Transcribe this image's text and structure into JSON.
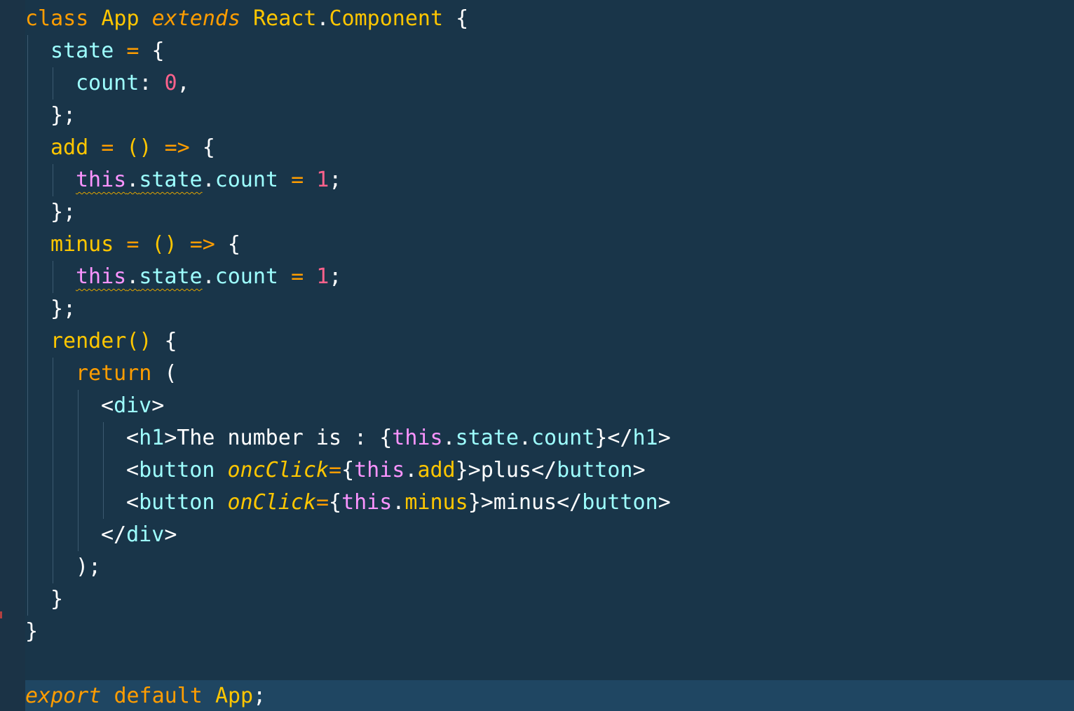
{
  "colors": {
    "background": "#193549",
    "gutter": "#1b3346",
    "active_line": "#1f4662",
    "keyword": "#ff9d00",
    "class_name": "#ffc600",
    "property": "#9effff",
    "this_keyword": "#fb94ff",
    "number": "#ff628c",
    "plain": "#ffffff",
    "indent_guide": "#3c5a70",
    "warning_squiggle": "#e0a400"
  },
  "editor": {
    "active_line_index": 21,
    "lines": [
      {
        "indent": 0,
        "tokens": [
          {
            "t": "class",
            "c": "keyword"
          },
          {
            "t": " "
          },
          {
            "t": "App",
            "c": "class_name"
          },
          {
            "t": " "
          },
          {
            "t": "extends",
            "c": "keyword",
            "italic": true
          },
          {
            "t": " "
          },
          {
            "t": "React",
            "c": "class_name"
          },
          {
            "t": "."
          },
          {
            "t": "Component",
            "c": "class_name"
          },
          {
            "t": " {"
          }
        ]
      },
      {
        "indent": 1,
        "tokens": [
          {
            "t": "state",
            "c": "property"
          },
          {
            "t": " "
          },
          {
            "t": "=",
            "c": "keyword"
          },
          {
            "t": " {"
          }
        ]
      },
      {
        "indent": 2,
        "tokens": [
          {
            "t": "count",
            "c": "property"
          },
          {
            "t": ": "
          },
          {
            "t": "0",
            "c": "number"
          },
          {
            "t": ","
          }
        ]
      },
      {
        "indent": 1,
        "tokens": [
          {
            "t": "};"
          }
        ]
      },
      {
        "indent": 1,
        "tokens": [
          {
            "t": "add",
            "c": "class_name"
          },
          {
            "t": " "
          },
          {
            "t": "=",
            "c": "keyword"
          },
          {
            "t": " "
          },
          {
            "t": "()",
            "c": "class_name"
          },
          {
            "t": " "
          },
          {
            "t": "=>",
            "c": "keyword"
          },
          {
            "t": " {"
          }
        ]
      },
      {
        "indent": 2,
        "tokens": [
          {
            "t": "this",
            "c": "this_keyword",
            "squiggle": true
          },
          {
            "t": ".",
            "squiggle": true
          },
          {
            "t": "state",
            "c": "property",
            "squiggle": true
          },
          {
            "t": "."
          },
          {
            "t": "count",
            "c": "property"
          },
          {
            "t": " "
          },
          {
            "t": "=",
            "c": "keyword"
          },
          {
            "t": " "
          },
          {
            "t": "1",
            "c": "number"
          },
          {
            "t": ";"
          }
        ]
      },
      {
        "indent": 1,
        "tokens": [
          {
            "t": "};"
          }
        ]
      },
      {
        "indent": 1,
        "tokens": [
          {
            "t": "minus",
            "c": "class_name"
          },
          {
            "t": " "
          },
          {
            "t": "=",
            "c": "keyword"
          },
          {
            "t": " "
          },
          {
            "t": "()",
            "c": "class_name"
          },
          {
            "t": " "
          },
          {
            "t": "=>",
            "c": "keyword"
          },
          {
            "t": " {"
          }
        ]
      },
      {
        "indent": 2,
        "tokens": [
          {
            "t": "this",
            "c": "this_keyword",
            "squiggle": true
          },
          {
            "t": ".",
            "squiggle": true
          },
          {
            "t": "state",
            "c": "property",
            "squiggle": true
          },
          {
            "t": "."
          },
          {
            "t": "count",
            "c": "property"
          },
          {
            "t": " "
          },
          {
            "t": "=",
            "c": "keyword"
          },
          {
            "t": " "
          },
          {
            "t": "1",
            "c": "number"
          },
          {
            "t": ";"
          }
        ]
      },
      {
        "indent": 1,
        "tokens": [
          {
            "t": "};"
          }
        ]
      },
      {
        "indent": 1,
        "tokens": [
          {
            "t": "render",
            "c": "class_name"
          },
          {
            "t": "()",
            "c": "class_name"
          },
          {
            "t": " {"
          }
        ]
      },
      {
        "indent": 2,
        "tokens": [
          {
            "t": "return",
            "c": "keyword"
          },
          {
            "t": " ("
          }
        ]
      },
      {
        "indent": 3,
        "tokens": [
          {
            "t": "<"
          },
          {
            "t": "div",
            "c": "property"
          },
          {
            "t": ">"
          }
        ]
      },
      {
        "indent": 4,
        "tokens": [
          {
            "t": "<"
          },
          {
            "t": "h1",
            "c": "property"
          },
          {
            "t": ">The number is : {"
          },
          {
            "t": "this",
            "c": "this_keyword"
          },
          {
            "t": "."
          },
          {
            "t": "state",
            "c": "property"
          },
          {
            "t": "."
          },
          {
            "t": "count",
            "c": "property"
          },
          {
            "t": "}</"
          },
          {
            "t": "h1",
            "c": "property"
          },
          {
            "t": ">"
          }
        ]
      },
      {
        "indent": 4,
        "tokens": [
          {
            "t": "<"
          },
          {
            "t": "button",
            "c": "property"
          },
          {
            "t": " "
          },
          {
            "t": "oncClick",
            "c": "class_name",
            "italic": true
          },
          {
            "t": "=",
            "c": "keyword"
          },
          {
            "t": "{"
          },
          {
            "t": "this",
            "c": "this_keyword"
          },
          {
            "t": "."
          },
          {
            "t": "add",
            "c": "class_name"
          },
          {
            "t": "}>plus</"
          },
          {
            "t": "button",
            "c": "property"
          },
          {
            "t": ">"
          }
        ]
      },
      {
        "indent": 4,
        "tokens": [
          {
            "t": "<"
          },
          {
            "t": "button",
            "c": "property"
          },
          {
            "t": " "
          },
          {
            "t": "onClick",
            "c": "class_name",
            "italic": true
          },
          {
            "t": "=",
            "c": "keyword"
          },
          {
            "t": "{"
          },
          {
            "t": "this",
            "c": "this_keyword"
          },
          {
            "t": "."
          },
          {
            "t": "minus",
            "c": "class_name"
          },
          {
            "t": "}>minus</"
          },
          {
            "t": "button",
            "c": "property"
          },
          {
            "t": ">"
          }
        ]
      },
      {
        "indent": 3,
        "tokens": [
          {
            "t": "</"
          },
          {
            "t": "div",
            "c": "property"
          },
          {
            "t": ">"
          }
        ]
      },
      {
        "indent": 2,
        "tokens": [
          {
            "t": ");"
          }
        ]
      },
      {
        "indent": 1,
        "tokens": [
          {
            "t": "}"
          }
        ]
      },
      {
        "indent": 0,
        "tokens": [
          {
            "t": "}"
          }
        ]
      },
      {
        "indent": 0,
        "tokens": []
      },
      {
        "indent": 0,
        "tokens": [
          {
            "t": "export",
            "c": "keyword",
            "italic": true
          },
          {
            "t": " "
          },
          {
            "t": "default",
            "c": "keyword"
          },
          {
            "t": " "
          },
          {
            "t": "App",
            "c": "class_name"
          },
          {
            "t": ";"
          }
        ]
      }
    ]
  }
}
